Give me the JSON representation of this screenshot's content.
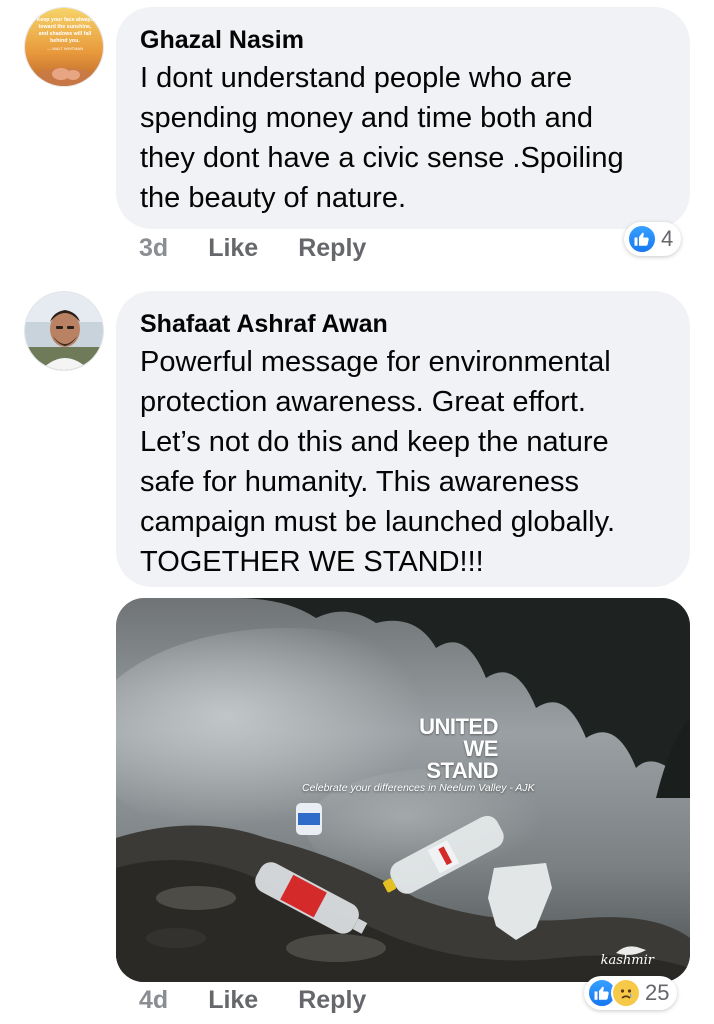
{
  "comments": [
    {
      "author": "Ghazal Nasim",
      "text": "I dont understand people who are\nspending money and time both and\nthey dont have a civic sense .Spoiling\nthe beauty of nature.",
      "time": "3d",
      "like_label": "Like",
      "reply_label": "Reply",
      "reaction_count": "4",
      "avatar_quote": [
        "Keep your face always",
        "toward the sunshine,",
        "and shadows will fall",
        "behind you.",
        "— WALT WHITMAN"
      ]
    },
    {
      "author": "Shafaat Ashraf Awan",
      "text": "Powerful message for environmental\nprotection awareness. Great effort.\nLet’s not do this and keep the nature\nsafe for humanity. This awareness\ncampaign must be launched globally.\nTOGETHER WE STAND!!!",
      "time": "4d",
      "like_label": "Like",
      "reply_label": "Reply",
      "reaction_count": "25",
      "attachment": {
        "headline": [
          "UNITED",
          "WE",
          "STAND"
        ],
        "caption": "Celebrate your differences in Neelum Valley - AJK",
        "watermark": "kashmir"
      }
    }
  ],
  "colors": {
    "bubble": "#f0f2f5",
    "meta_text": "#65676b",
    "like_blue": "#1877f2",
    "sad_yellow": "#f7c948"
  },
  "icons": [
    "like-reaction-icon",
    "sad-reaction-icon"
  ]
}
